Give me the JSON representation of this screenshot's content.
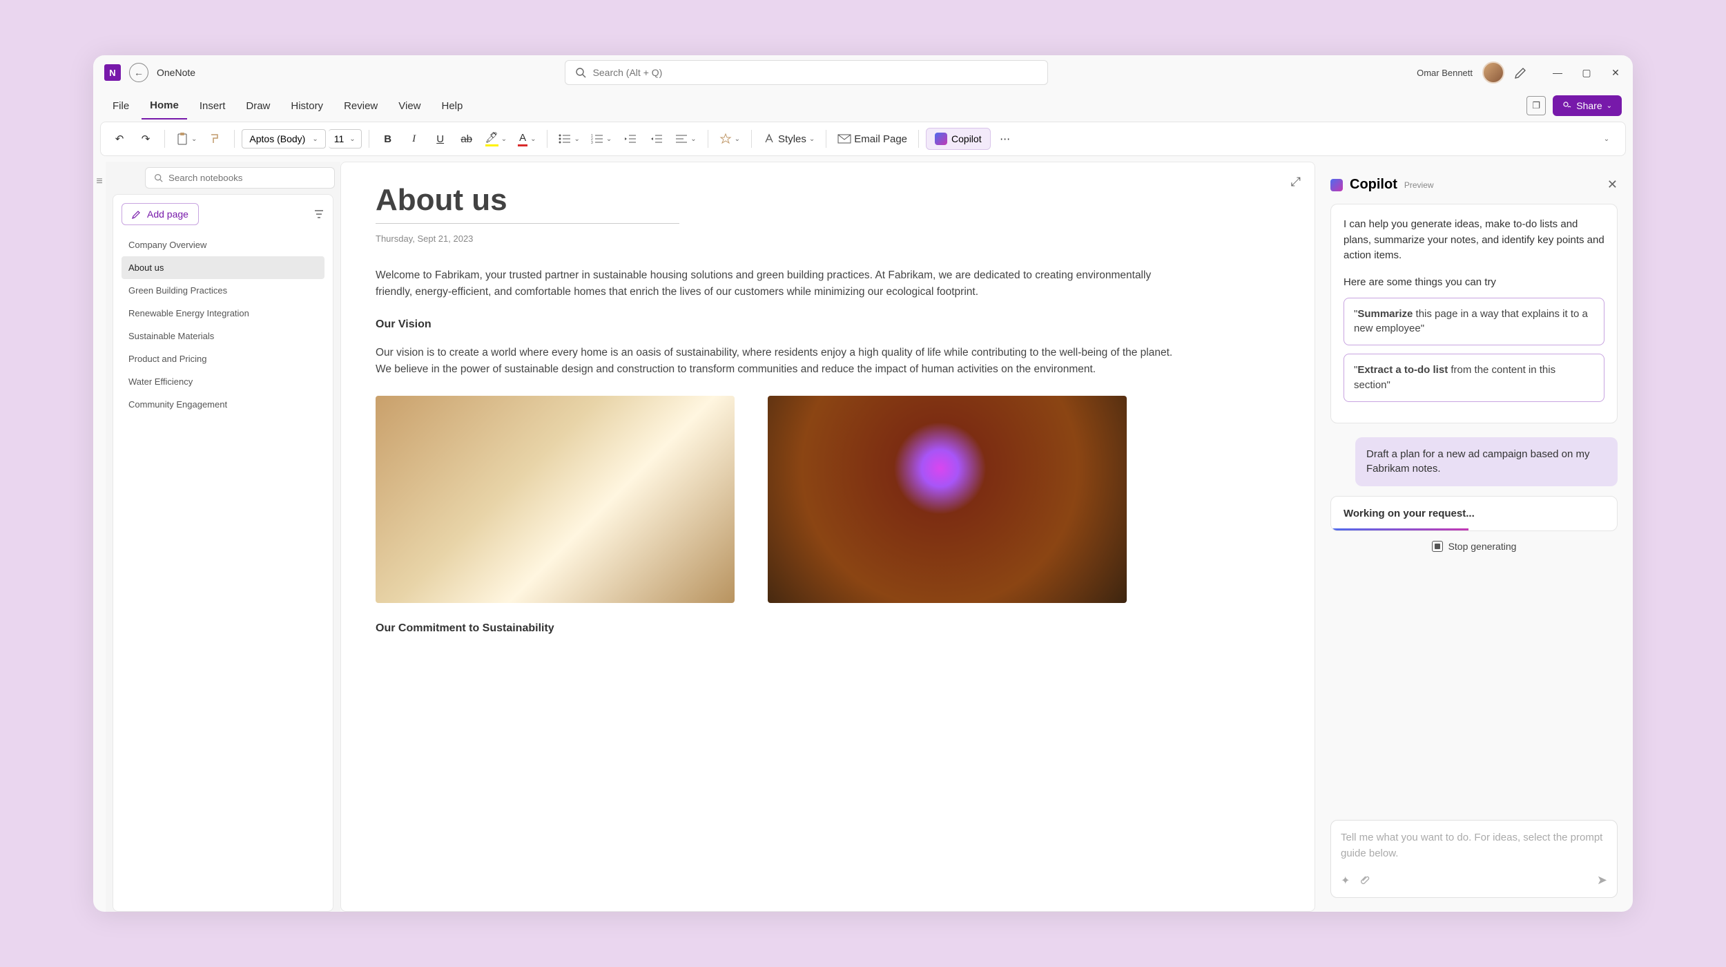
{
  "app": {
    "name": "OneNote"
  },
  "search": {
    "placeholder": "Search (Alt + Q)"
  },
  "user": {
    "name": "Omar Bennett"
  },
  "tabs": [
    "File",
    "Home",
    "Insert",
    "Draw",
    "History",
    "Review",
    "View",
    "Help"
  ],
  "share": {
    "label": "Share"
  },
  "ribbon": {
    "font": "Aptos (Body)",
    "size": "11",
    "styles": "Styles",
    "email": "Email Page",
    "copilot": "Copilot"
  },
  "nb_search": {
    "placeholder": "Search notebooks"
  },
  "sidebar": {
    "add_page": "Add page",
    "pages": [
      "Company Overview",
      "About us",
      "Green Building Practices",
      "Renewable Energy Integration",
      "Sustainable Materials",
      "Product and Pricing",
      "Water Efficiency",
      "Community Engagement"
    ]
  },
  "page": {
    "title": "About us",
    "date": "Thursday, Sept 21, 2023",
    "intro": "Welcome to Fabrikam, your trusted partner in sustainable housing solutions and green building practices. At Fabrikam, we are dedicated to creating environmentally friendly, energy-efficient, and comfortable homes that enrich the lives of our customers while minimizing our ecological footprint.",
    "vision_h": "Our Vision",
    "vision_body": "Our vision is to create a world where every home is an oasis of sustainability, where residents enjoy a high quality of life while contributing to the well-being of the planet. We believe in the power of sustainable design and construction to transform communities and reduce the impact of human activities on the environment.",
    "commit_h": "Our Commitment to Sustainability"
  },
  "copilot": {
    "title": "Copilot",
    "badge": "Preview",
    "intro": "I can help you generate ideas, make to-do lists and plans, summarize your notes, and identify key points and action items.",
    "try": "Here are some things you can try",
    "sug1_bold": "Summarize",
    "sug1_rest": " this page in a way that explains it to a new employee\"",
    "sug2_bold": "Extract a to-do list",
    "sug2_rest": " from the content in this section\"",
    "user_msg": "Draft a plan for a new ad campaign based on my Fabrikam notes.",
    "working": "Working on your request...",
    "stop": "Stop generating",
    "placeholder": "Tell me what you want to do. For ideas, select the prompt guide below."
  }
}
